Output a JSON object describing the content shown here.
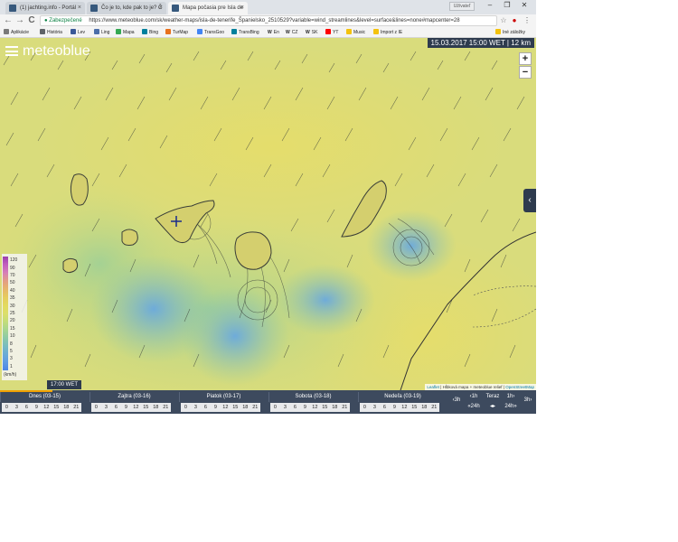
{
  "browser": {
    "tabs": [
      {
        "title": "(1) jachting.info - Portál"
      },
      {
        "title": "Čo je to, kde pak to je? Č"
      },
      {
        "title": "Mapa počasia pre Isla de"
      }
    ],
    "profile_label": "Užívateľ",
    "window_controls": {
      "minimize": "–",
      "maximize": "❐",
      "close": "✕"
    },
    "nav": {
      "back": "←",
      "forward": "→",
      "reload": "C"
    },
    "secure_label": "Zabezpečené",
    "url": "https://www.meteoblue.com/sk/weather-maps/isla-de-tenerife_Španielsko_2510529?variable=wind_streamlines&level=surface&lines=none#mapcenter=28",
    "toolbar_icons": [
      "star-icon",
      "extension-icon",
      "menu-icon"
    ],
    "bookmarks": [
      {
        "label": "Aplikácie",
        "color": "#7a7a7a"
      },
      {
        "label": "História",
        "color": "#5f6368"
      },
      {
        "label": "Lev",
        "color": "#3b5998"
      },
      {
        "label": "Ling",
        "color": "#4b6ea9"
      },
      {
        "label": "Mapa",
        "color": "#34a853"
      },
      {
        "label": "Bing",
        "color": "#00809d"
      },
      {
        "label": "TurMap",
        "color": "#e8711c"
      },
      {
        "label": "TransGoo",
        "color": "#4285f4"
      },
      {
        "label": "TransBing",
        "color": "#00809d"
      },
      {
        "label": "En",
        "color": "#222222"
      },
      {
        "label": "CZ",
        "color": "#222222"
      },
      {
        "label": "SK",
        "color": "#222222"
      },
      {
        "label": "YT",
        "color": "#ff0000"
      },
      {
        "label": "Music",
        "color": "#f4c20d"
      },
      {
        "label": "Import z IE",
        "color": "#f4c20d"
      }
    ],
    "other_bookmarks": "Iné záložky"
  },
  "map": {
    "logo": "meteoblue",
    "datetime": "15.03.2017 15:00 WET | 12 km",
    "zoom_in": "+",
    "zoom_out": "−",
    "panel_toggle": "‹",
    "time_badge": "17:00 WET",
    "attribution_prefix": "Leaflet",
    "attribution_text": "| Hĺbková mapa + meteoblue relief |",
    "attribution_osm": "OpenStreetMap",
    "legend": {
      "unit": "(km/h)",
      "ticks": [
        "120",
        "90",
        "70",
        "50",
        "40",
        "35",
        "30",
        "25",
        "20",
        "15",
        "10",
        "8",
        "5",
        "3",
        "1"
      ],
      "colors": [
        "#9b3fae",
        "#c25fbf",
        "#d77fb8",
        "#e39e84",
        "#e7b66a",
        "#e6cc5e",
        "#e3da5e",
        "#dcdf6a",
        "#c4dd79",
        "#a7d690",
        "#8ccaa6",
        "#78bcc0",
        "#6aacd6",
        "#5f9be3",
        "#4d86e6"
      ]
    }
  },
  "timeline": {
    "days": [
      "Dnes (03-15)",
      "Zajtra (03-16)",
      "Piatok (03-17)",
      "Sobota (03-18)",
      "Nedeľa (03-19)"
    ],
    "hours": [
      "0",
      "3",
      "6",
      "9",
      "12",
      "15",
      "18",
      "21"
    ],
    "steps": {
      "back_3h": "3h",
      "back_1h": "1h",
      "back_24h": "24h",
      "now": "Teraz",
      "fwd_1h": "1h",
      "fwd_24h": "24h",
      "fwd_3h": "3h"
    }
  }
}
